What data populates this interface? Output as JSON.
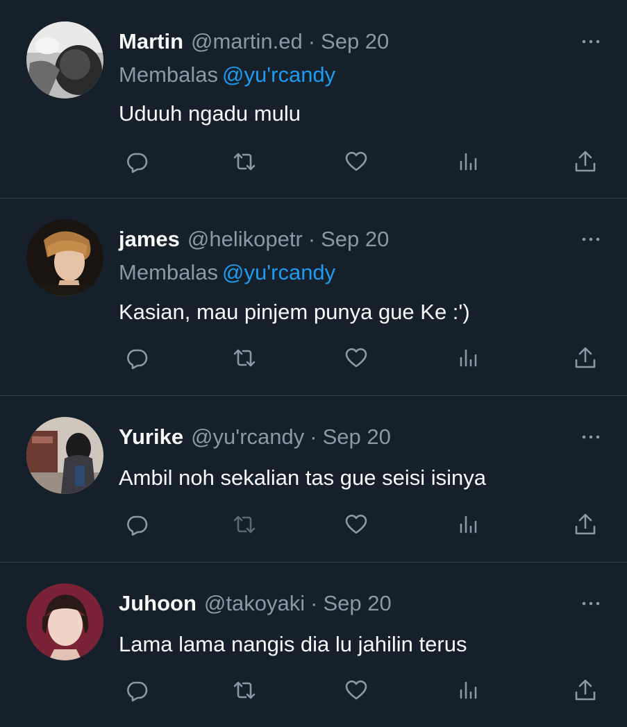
{
  "colors": {
    "background": "#15202b",
    "text": "#f7f9f9",
    "secondary_text": "#8b98a5",
    "link": "#1d9bf0",
    "divider": "#38444d"
  },
  "reply_prefix": "Membalas",
  "tweets": [
    {
      "name": "Martin",
      "handle": "@martin.ed",
      "separator": "·",
      "date": "Sep 20",
      "reply_to": "@yu'rcandy",
      "text": "Uduuh ngadu mulu",
      "avatar": "avatar-martin"
    },
    {
      "name": "james",
      "handle": "@helikopetr",
      "separator": "·",
      "date": "Sep 20",
      "reply_to": "@yu'rcandy",
      "text": "Kasian, mau pinjem punya gue Ke :')",
      "avatar": "avatar-james"
    },
    {
      "name": "Yurike",
      "handle": "@yu'rcandy",
      "separator": "·",
      "date": "Sep 20",
      "text": "Ambil noh sekalian tas gue seisi isinya",
      "avatar": "avatar-yurike"
    },
    {
      "name": "Juhoon",
      "handle": "@takoyaki",
      "separator": "·",
      "date": "Sep 20",
      "text": "Lama lama nangis dia lu jahilin terus",
      "avatar": "avatar-juhoon"
    }
  ],
  "action_icons": [
    "reply-icon",
    "retweet-icon",
    "like-icon",
    "views-icon",
    "share-icon"
  ],
  "more_icon": "more-options-icon"
}
